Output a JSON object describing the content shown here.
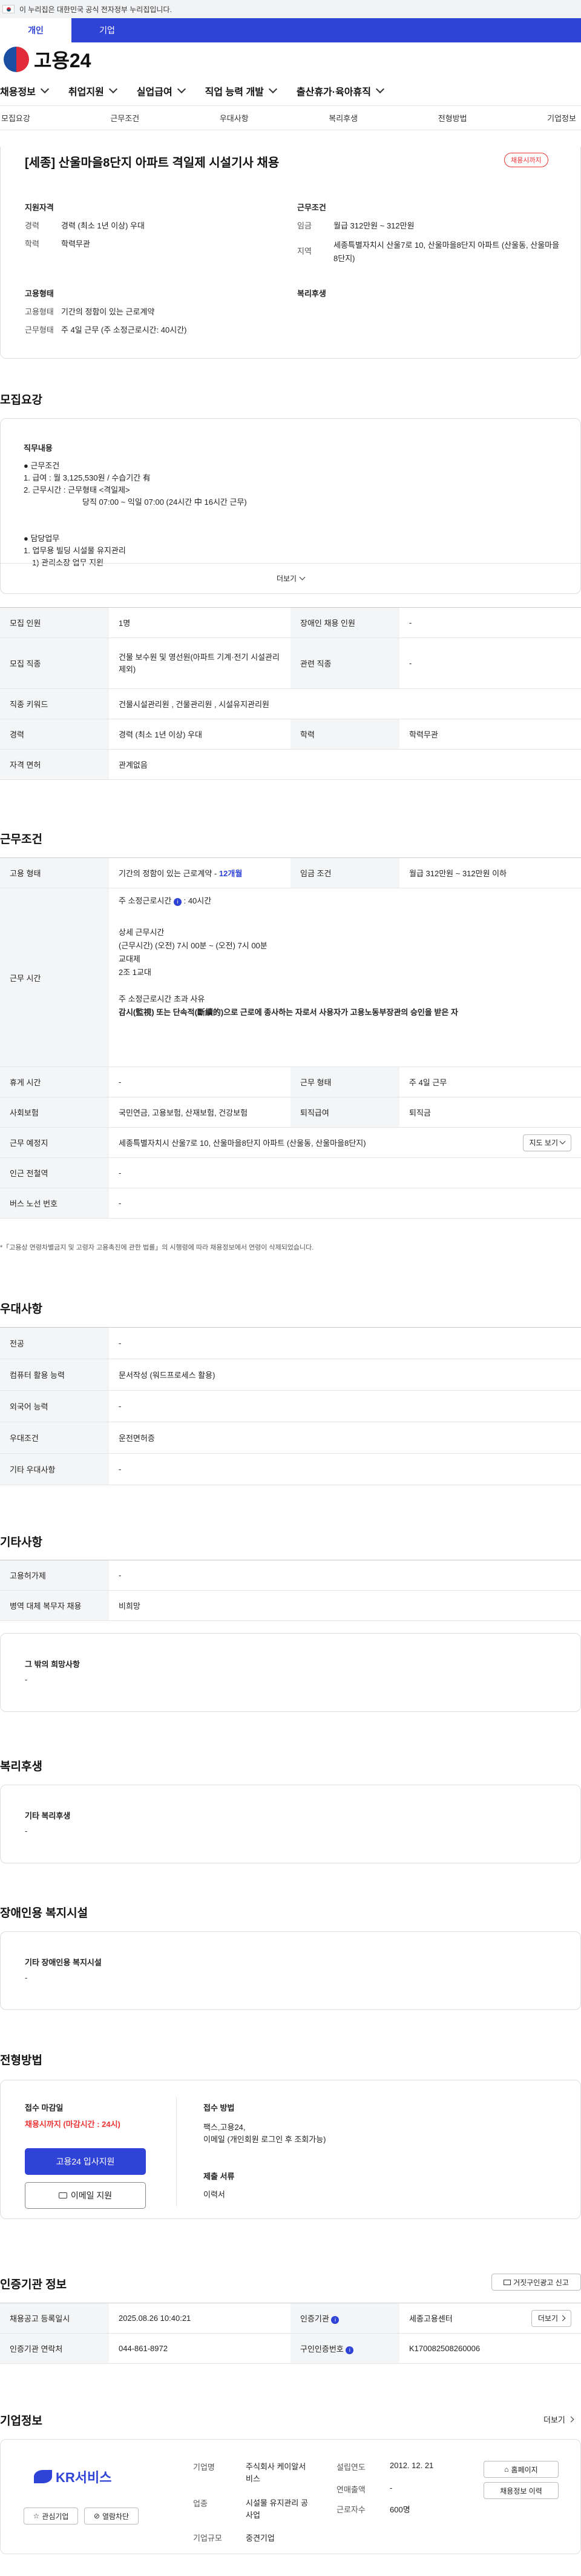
{
  "gov_banner": "이 누리집은 대한민국 공식 전자정부 누리집입니다.",
  "tabs": [
    "개인",
    "기업"
  ],
  "logo": "고용24",
  "gnb": [
    "채용정보",
    "취업지원",
    "실업급여",
    "직업 능력 개발",
    "출산휴가·육아휴직"
  ],
  "subnav": [
    "모집요강",
    "근무조건",
    "우대사항",
    "복리후생",
    "전형방법",
    "기업정보"
  ],
  "summary": {
    "title": "[세종] 산울마을8단지 아파트 격일제 시설기사 채용",
    "badge": "채용시까지",
    "col1_title": "지원자격",
    "career_k": "경력",
    "career_v": "경력 (최소 1년 이상) 우대",
    "edu_k": "학력",
    "edu_v": "학력무관",
    "col2_title": "근무조건",
    "wage_k": "임금",
    "wage_v": "월급 312만원 ~ 312만원",
    "area_k": "지역",
    "area_v": "세종특별자치시 산울7로 10, 산울마을8단지 아파트 (산울동, 산울마을8단지)",
    "col3_title": "고용형태",
    "emp_k": "고용형태",
    "emp_v": "기간의 정함이 있는 근로계약",
    "work_k": "근무형태",
    "work_v": "주 4일 근무 (주 소정근로시간: 40시간)",
    "col4_title": "복리후생"
  },
  "recruit": {
    "title": "모집요강",
    "duty_title": "직무내용",
    "duty_lines": [
      "● 근무조건",
      "1. 급여 : 월 3,125,530원 / 수습기간 有",
      "2. 근무시간 : 근무형태 <격일제>",
      "당직 07:00 ~ 익일 07:00 (24시간 中 16시간 근무)",
      "",
      "",
      "● 담당업무",
      "1. 업무용 빌딩 시설물 유지관리",
      "1) 관리소장 업무 지원"
    ],
    "more": "더보기",
    "rows": [
      {
        "k": "모집 인원",
        "v": "1명",
        "k2": "장애인 채용 인원",
        "v2": "-"
      },
      {
        "k": "모집 직종",
        "v": "건물 보수원 및 영선원(아파트 기계·전기 시설관리 제외)",
        "k2": "관련 직종",
        "v2": "-"
      },
      {
        "k": "직종 키워드",
        "v": "건물시설관리원 , 건물관리원 , 시설유지관리원"
      },
      {
        "k": "경력",
        "v": "경력 (최소 1년 이상) 우대",
        "k2": "학력",
        "v2": "학력무관"
      },
      {
        "k": "자격 면허",
        "v": "관계없음"
      }
    ]
  },
  "cond": {
    "title": "근무조건",
    "emp_k": "고용 형태",
    "emp_v": "기간의 정함이 있는 근로계약 - ",
    "emp_link": "12개월",
    "wage_k": "임금 조건",
    "wage_v": "월급 312만원 ~ 312만원 이하",
    "time_k": "근무 시간",
    "time_lines": [
      "주 소정근로시간",
      "40시간",
      "상세 근무시간",
      "(근무시간) (오전) 7시 00분 ~ (오전) 7시 00분",
      "교대제",
      "2조 1교대",
      "주 소정근로시간 초과 사유",
      "감시(監視) 또는 단속적(斷續的)으로 근로에 종사하는 자로서 사용자가 고용노동부장관의 승인을 받은 자"
    ],
    "rest_k": "휴게 시간",
    "rest_v": "-",
    "form_k": "근무 형태",
    "form_v": "주 4일 근무",
    "ins_k": "사회보험",
    "ins_v": "국민연금, 고용보험, 산재보험, 건강보험",
    "ret_k": "퇴직급여",
    "ret_v": "퇴직금",
    "place_k": "근무 예정지",
    "place_v": "세종특별자치시 산울7로 10, 산울마을8단지 아파트 (산울동, 산울마을8단지)",
    "map_btn": "지도 보기",
    "sub_k": "인근 전철역",
    "sub_v": "-",
    "bus_k": "버스 노선 번호",
    "bus_v": "-",
    "note": "*「고용상 연령차별금지 및 고령자 고용촉진에 관한 법률」의 시행령에 따라 채용정보에서 연령이 삭제되었습니다."
  },
  "pref": {
    "title": "우대사항",
    "rows": [
      {
        "k": "전공",
        "v": "-"
      },
      {
        "k": "컴퓨터 활용 능력",
        "v": "문서작성 (워드프로세스 활용)"
      },
      {
        "k": "외국어 능력",
        "v": "-"
      },
      {
        "k": "우대조건",
        "v": "운전면허증"
      },
      {
        "k": "기타 우대사항",
        "v": "-"
      }
    ]
  },
  "etc": {
    "title": "기타사항",
    "rows": [
      {
        "k": "고용허가제",
        "v": "-"
      },
      {
        "k": "병역 대체 복무자 채용",
        "v": "비희망"
      }
    ],
    "box_title": "그 밖의 희망사항",
    "box_v": "-"
  },
  "welfare": {
    "title": "복리후생",
    "box_title": "기타 복리후생",
    "box_v": "-"
  },
  "disab": {
    "title": "장애인용 복지시설",
    "box_title": "기타 장애인용 복지시설",
    "box_v": "-"
  },
  "process": {
    "title": "전형방법",
    "deadline_k": "접수 마감일",
    "deadline_v": "채용시까지 (마감시간 : 24시)",
    "apply_btn": "고용24 입사지원",
    "email_btn": "이메일 지원",
    "method_k": "접수 방법",
    "method_v": "팩스,고용24,",
    "method_v2": "이메일 (개인회원 로그인 후 조회가능)",
    "docs_k": "제출 서류",
    "docs_v": "이력서"
  },
  "org": {
    "title": "인증기관 정보",
    "report_btn": "거짓구인광고 신고",
    "reg_k": "채용공고 등록일시",
    "reg_v": "2025.08.26 10:40:21",
    "cert_k": "인증기관",
    "cert_v": "세종고용센터",
    "more_btn": "더보기",
    "tel_k": "인증기관 연락처",
    "tel_v": "044-861-8972",
    "no_k": "구인인증번호",
    "no_v": "K170082508260006"
  },
  "company": {
    "title": "기업정보",
    "more": "더보기",
    "logo": "KR서비스",
    "fav_btn": "관심기업",
    "block_btn": "열람차단",
    "ceo_k": "기업명",
    "ceo_v": "주식회사 케이알서비스",
    "ind_k": "업종",
    "ind_v": "시설물 유지관리 공사업",
    "size_k": "기업규모",
    "size_v": "중견기업",
    "est_k": "설립연도",
    "est_v": "2012. 12. 21",
    "rev_k": "연매출액",
    "rev_v": "-",
    "emp_k": "근로자수",
    "emp_v": "600명",
    "home_btn": "홈페이지",
    "hist_btn": "채용정보 이력"
  },
  "colors": {
    "brand_blue": "#2f43d6",
    "badge_red": "#e33333",
    "link_blue": "#2f43d6"
  }
}
